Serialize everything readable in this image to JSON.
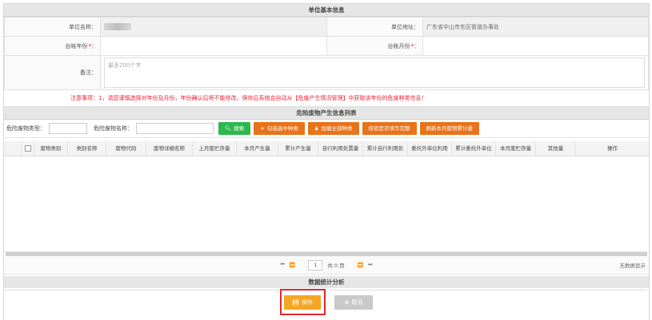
{
  "unit_section": {
    "title": "单位基本信息",
    "unit_name_label": "单位名称：",
    "unit_address_label": "单位地址：",
    "unit_address_value": "广东省中山市东区街道办事处",
    "year_label": "台帐年份",
    "month_label": "台帐月份",
    "required_mark": "*",
    "colon": "：",
    "remark_label": "备注：",
    "remark_placeholder": "最多200个字"
  },
  "notice": {
    "label": "注意事项：",
    "text": "1，请您谨慎选择对年份及月份，年份确认后将不能修改，保存后系统会自动从【危废产生情况管理】中获取该年份的危废种类信息！"
  },
  "list_section": {
    "title": "危险废物产生信息列表",
    "filter_type_label": "危险废物类型：",
    "filter_name_label": "危险废物名称：",
    "buttons": {
      "search": "搜索",
      "add_selected": "勾选选中种类",
      "add_all": "加载全部种类",
      "check_fill": "校验是否填写完整",
      "refresh_month": "刷新本月废物累计量"
    },
    "columns": [
      "废物类别",
      "类别名称",
      "废物代码",
      "废物详细名称",
      "上月废贮存量",
      "本月产生量",
      "累计产生量",
      "自行利用处置量",
      "累计自行利用处",
      "委托外单位利用",
      "累计委托外单位",
      "本月废贮存量",
      "其他量",
      "操作"
    ],
    "pager": {
      "current_page": "1",
      "total_text": "共 0 页",
      "no_data": "无数据显示"
    }
  },
  "stats_section": {
    "title": "数据统计分析"
  },
  "actions": {
    "save": "保存",
    "cancel": "取消"
  },
  "colors": {
    "search_green": "#2db84d",
    "action_orange": "#e8731a",
    "save_yellow": "#f5a623",
    "cancel_gray": "#c9c9c9",
    "highlight_red": "#e0272f",
    "notice_red": "#e22233"
  }
}
